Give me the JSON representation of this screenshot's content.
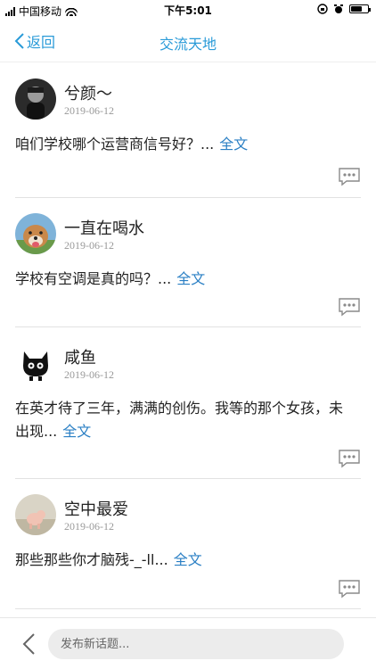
{
  "status_bar": {
    "carrier": "中国移动",
    "time": "下午5:01"
  },
  "nav": {
    "back_label": "返回",
    "title": "交流天地"
  },
  "posts": [
    {
      "author": "兮颜～",
      "date": "2019-06-12",
      "text": "咱们学校哪个运营商信号好？...",
      "more": "全文",
      "avatar": "avatar-dark-portrait"
    },
    {
      "author": "一直在喝水",
      "date": "2019-06-12",
      "text": "学校有空调是真的吗？...",
      "more": "全文",
      "avatar": "avatar-dog"
    },
    {
      "author": "咸鱼",
      "date": "2019-06-12",
      "text": "在英才待了三年，满满的创伤。我等的那个女孩，未出现...",
      "more": "全文",
      "avatar": "avatar-black-cat"
    },
    {
      "author": "空中最爱",
      "date": "2019-06-12",
      "text": "那些那些你才脑残-_-ll...",
      "more": "全文",
      "avatar": "avatar-pig-toy"
    }
  ],
  "compose": {
    "placeholder": "发布新话题..."
  },
  "colors": {
    "accent": "#2a9bd8",
    "link": "#2a7fc4"
  }
}
